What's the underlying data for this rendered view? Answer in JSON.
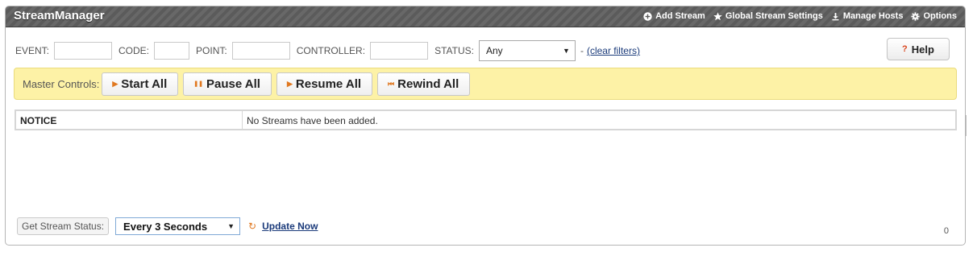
{
  "app": {
    "title": "StreamManager"
  },
  "header_actions": [
    {
      "label": "Add Stream",
      "icon": "plus-circle-icon"
    },
    {
      "label": "Global Stream Settings",
      "icon": "star-icon"
    },
    {
      "label": "Manage Hosts",
      "icon": "download-icon"
    },
    {
      "label": "Options",
      "icon": "gear-icon"
    }
  ],
  "filters": {
    "event_label": "EVENT:",
    "event_value": "",
    "code_label": "CODE:",
    "code_value": "",
    "point_label": "POINT:",
    "point_value": "",
    "controller_label": "CONTROLLER:",
    "controller_value": "",
    "status_label": "STATUS:",
    "status_selected": "Any",
    "dash": "-",
    "clear_label": "(clear filters)"
  },
  "help": {
    "icon_text": "?",
    "label": "Help"
  },
  "master_controls": {
    "label": "Master Controls:",
    "buttons": [
      {
        "label": "Start All",
        "icon": "play-icon",
        "glyph": "▶"
      },
      {
        "label": "Pause All",
        "icon": "pause-icon",
        "glyph": "❚❚"
      },
      {
        "label": "Resume All",
        "icon": "play-icon",
        "glyph": "▶"
      },
      {
        "label": "Rewind All",
        "icon": "rewind-icon",
        "glyph": "⏮"
      }
    ]
  },
  "notice": {
    "header": "NOTICE",
    "message": "No Streams have been added."
  },
  "stream_status": {
    "label": "Get Stream Status:",
    "selected": "Every 3 Seconds",
    "update_label": "Update Now",
    "counter": "0"
  },
  "colors": {
    "titlebar": "#5b5b5b",
    "master_bar": "#fdf2a6",
    "accent_orange": "#e07820",
    "link": "#1a3a7a"
  }
}
